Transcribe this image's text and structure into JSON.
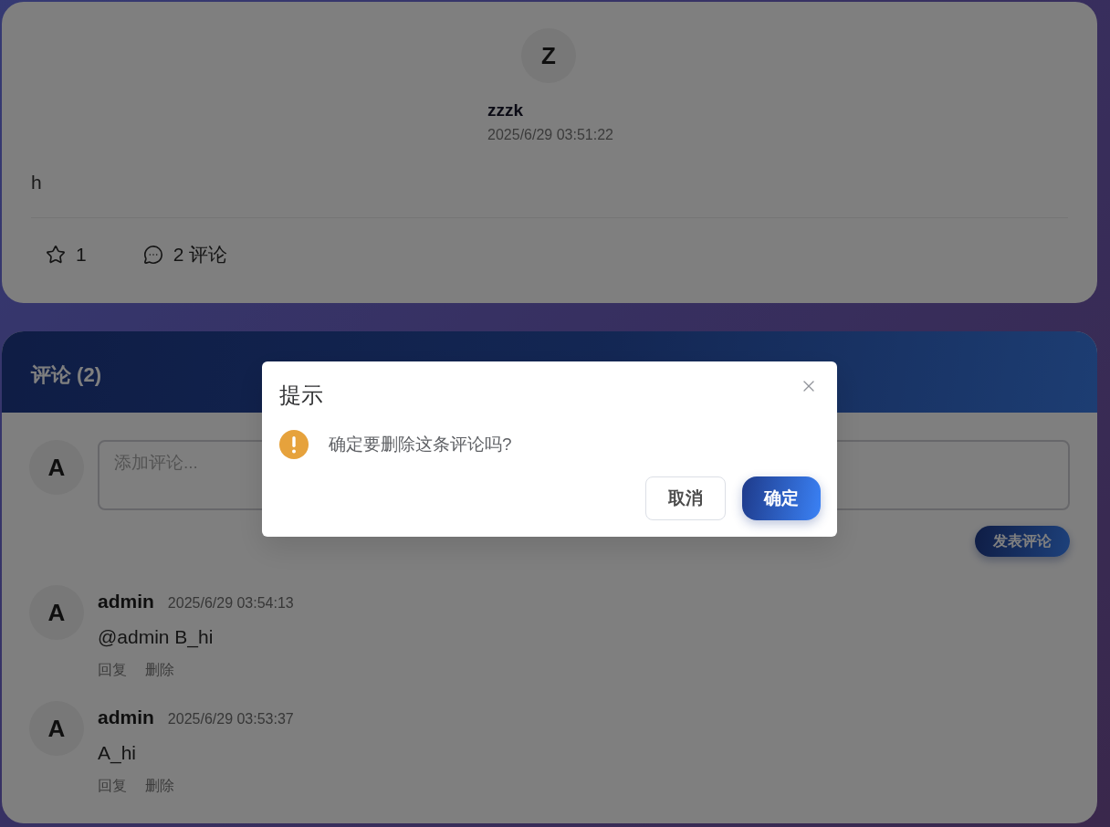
{
  "post": {
    "avatar": "Z",
    "author": "zzzk",
    "time": "2025/6/29 03:51:22",
    "content": "h",
    "actions": [
      {
        "kind": "like",
        "label": "1"
      },
      {
        "kind": "comment",
        "label": "2 评论"
      }
    ]
  },
  "comments_panel": {
    "title": "评论 (2)",
    "composer": {
      "avatar": "A",
      "placeholder": "添加评论...",
      "submit": "发表评论"
    },
    "comments": [
      {
        "avatar": "A",
        "author": "admin",
        "time": "2025/6/29 03:54:13",
        "text": "@admin B_hi",
        "actions": [
          "回复",
          "删除"
        ]
      },
      {
        "avatar": "A",
        "author": "admin",
        "time": "2025/6/29 03:53:37",
        "text": "A_hi",
        "actions": [
          "回复",
          "删除"
        ]
      }
    ]
  },
  "dialog": {
    "title": "提示",
    "message": "确定要删除这条评论吗?",
    "buttons": [
      {
        "kind": "secondary",
        "label": "取消"
      },
      {
        "kind": "primary",
        "label": "确定"
      }
    ]
  }
}
